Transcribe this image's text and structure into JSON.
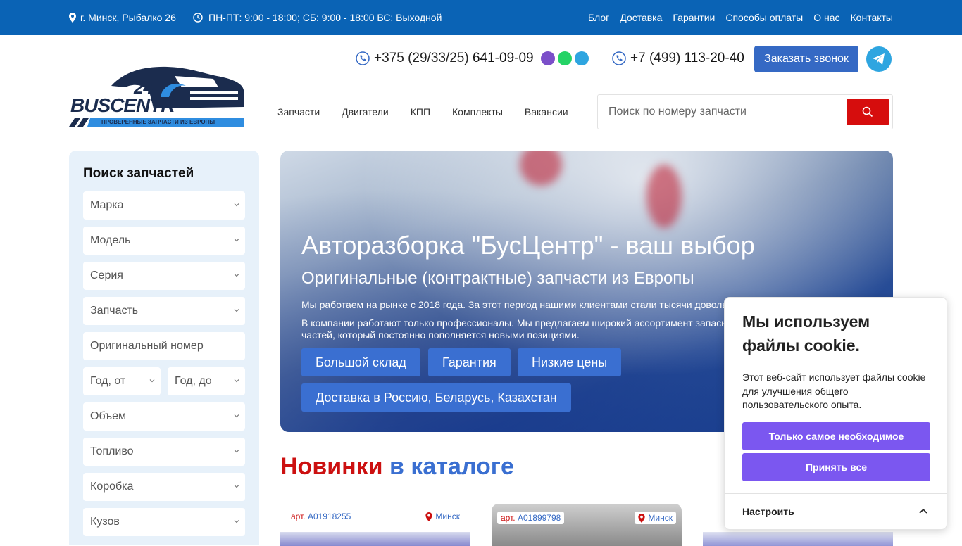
{
  "topbar": {
    "address": "г. Минск, Рыбалко 26",
    "hours": "ПН-ПТ: 9:00 - 18:00; СБ: 9:00 - 18:00 ВС: Выходной",
    "nav": [
      "Блог",
      "Доставка",
      "Гарантии",
      "Способы оплаты",
      "О нас",
      "Контакты"
    ]
  },
  "brand": {
    "logo_number": "24",
    "logo_name": "BUSCENTR",
    "logo_tagline": "ПРОВЕРЕННЫЕ ЗАПЧАСТИ ИЗ ЕВРОПЫ",
    "colors": {
      "navy": "#1b2c4e",
      "blue": "#0a63b5",
      "accent_blue": "#3a6fd1",
      "red": "#cc1010",
      "cookie_purple": "#7b57f0"
    }
  },
  "contacts": {
    "phone1_prefix": "+375 (29/33/25)",
    "phone1_number": "641-09-09",
    "phone2_prefix": "+7 (499)",
    "phone2_number": "113-20-40",
    "callback_button": "Заказать звонок",
    "messenger_icons": [
      "viber-icon",
      "whatsapp-icon",
      "telegram-icon"
    ]
  },
  "mainnav": [
    "Запчасти",
    "Двигатели",
    "КПП",
    "Комплекты",
    "Вакансии"
  ],
  "search": {
    "placeholder": "Поиск по номеру запчасти"
  },
  "sidebar": {
    "title": "Поиск запчастей",
    "fields": {
      "brand": "Марка",
      "model": "Модель",
      "series": "Серия",
      "part": "Запчасть",
      "original_number": "Оригинальный номер",
      "year_from": "Год, от",
      "year_to": "Год, до",
      "volume": "Объем",
      "fuel": "Топливо",
      "gearbox": "Коробка",
      "body": "Кузов"
    }
  },
  "hero": {
    "title": "Авторазборка \"БусЦентр\" - ваш выбор",
    "subtitle": "Оригинальные (контрактные) запчасти из Европы",
    "text1": "Мы работаем на рынке с 2018 года. За этот период нашими клиентами стали тысячи довольных покупателей.",
    "text2": "В компании работают только профессионалы. Мы предлагаем широкий ассортимент запасных частей, который постоянно пополняется новыми позициями.",
    "tags": [
      "Большой склад",
      "Гарантия",
      "Низкие цены",
      "Доставка в Россию, Беларусь, Казахстан"
    ]
  },
  "catalog": {
    "title_red": "Новинки",
    "title_blue": "в каталоге",
    "cards": [
      {
        "art_label": "арт.",
        "art": "A01918255",
        "city": "Минск"
      },
      {
        "art_label": "арт.",
        "art": "A01899798",
        "city": "Минск"
      },
      {
        "art_label": "арт.",
        "art": "",
        "city": ""
      }
    ]
  },
  "cookie": {
    "title": "Мы используем файлы cookie.",
    "text": "Этот веб-сайт использует файлы cookie для улучшения общего пользовательского опыта.",
    "necessary_button": "Только самое необходимое",
    "accept_button": "Принять все",
    "settings_label": "Настроить"
  }
}
